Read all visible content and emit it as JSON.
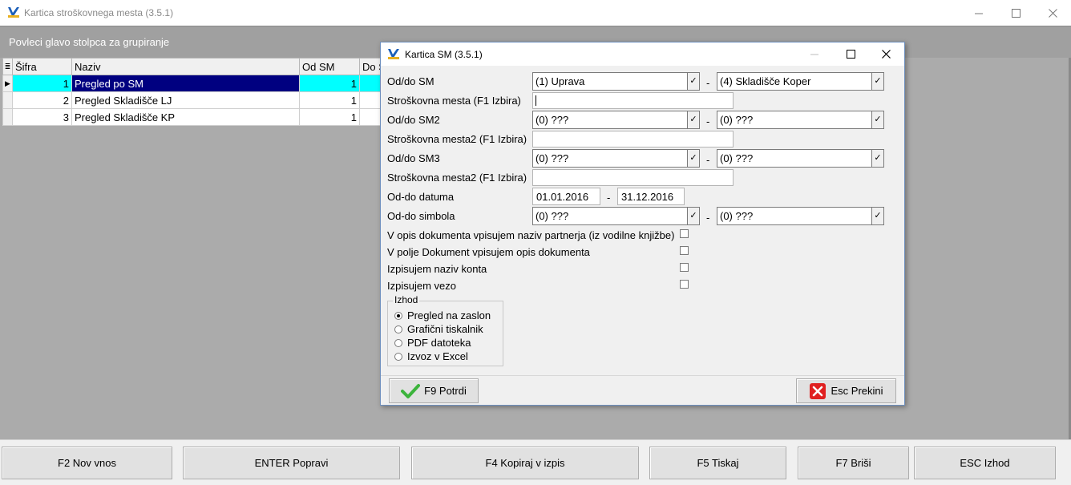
{
  "window": {
    "title": "Kartica stroškovnega mesta  (3.5.1)"
  },
  "group_bar": {
    "text": "Povleci glavo stolpca za grupiranje"
  },
  "grid": {
    "columns": [
      "Šifra",
      "Naziv",
      "Od SM",
      "Do S"
    ],
    "rows": [
      {
        "sifra": "1",
        "naziv": "Pregled po SM",
        "od_sm": "1",
        "selected": true
      },
      {
        "sifra": "2",
        "naziv": "Pregled Skladišče LJ",
        "od_sm": "1",
        "selected": false
      },
      {
        "sifra": "3",
        "naziv": "Pregled Skladišče KP",
        "od_sm": "1",
        "selected": false
      }
    ]
  },
  "bottom_buttons": [
    "F2 Nov vnos",
    "ENTER Popravi",
    "F4 Kopiraj v izpis",
    "F5 Tiskaj",
    "F7 Briši",
    "ESC Izhod"
  ],
  "dialog": {
    "title": "Kartica SM  (3.5.1)",
    "labels": {
      "od_do_sm": "Od/do SM",
      "stroskovna_mesta": "Stroškovna mesta (F1 Izbira)",
      "od_do_sm2": "Od/do SM2",
      "stroskovna_mesta2": "Stroškovna mesta2 (F1 Izbira)",
      "od_do_sm3": "Od/do SM3",
      "stroskovna_mesta3": "Stroškovna mesta2 (F1 Izbira)",
      "od_do_datuma": "Od-do datuma",
      "od_do_simbola": "Od-do simbola"
    },
    "separator": "-",
    "combo_arrow": "✓",
    "sm_from": "(1) Uprava",
    "sm_to": "(4) Skladišče Koper",
    "stroskovna_mesta_value": "",
    "sm2_from": "(0) ???",
    "sm2_to": "(0) ???",
    "stroskovna_mesta2_value": "",
    "sm3_from": "(0) ???",
    "sm3_to": "(0) ???",
    "stroskovna_mesta3_value": "",
    "date_from": "01.01.2016",
    "date_to": "31.12.2016",
    "simbol_from": "(0) ???",
    "simbol_to": "(0) ???",
    "checkboxes": [
      {
        "label": "V opis dokumenta vpisujem naziv partnerja (iz vodilne knjižbe)",
        "checked": false
      },
      {
        "label": "V polje Dokument vpisujem opis dokumenta",
        "checked": false
      },
      {
        "label": "Izpisujem naziv konta",
        "checked": false
      },
      {
        "label": "Izpisujem vezo",
        "checked": false
      }
    ],
    "output_group": {
      "title": "Izhod",
      "options": [
        {
          "label": "Pregled na zaslon",
          "selected": true
        },
        {
          "label": "Grafični tiskalnik",
          "selected": false
        },
        {
          "label": "PDF datoteka",
          "selected": false
        },
        {
          "label": "Izvoz v Excel",
          "selected": false
        }
      ]
    },
    "confirm_label": "F9 Potrdi",
    "cancel_label": "Esc Prekini"
  },
  "colors": {
    "selected_row": "#000080",
    "selected_cell": "#00ffff",
    "group_bar": "#a0a0a0",
    "grid_background": "#ababab",
    "confirm_icon": "#3cb43c",
    "cancel_icon": "#e02020"
  },
  "icons": {
    "app": "app-logo-icon",
    "minimize": "minimize-icon",
    "maximize": "maximize-icon",
    "close": "close-icon",
    "confirm": "checkmark-icon",
    "cancel": "cancel-x-icon"
  }
}
